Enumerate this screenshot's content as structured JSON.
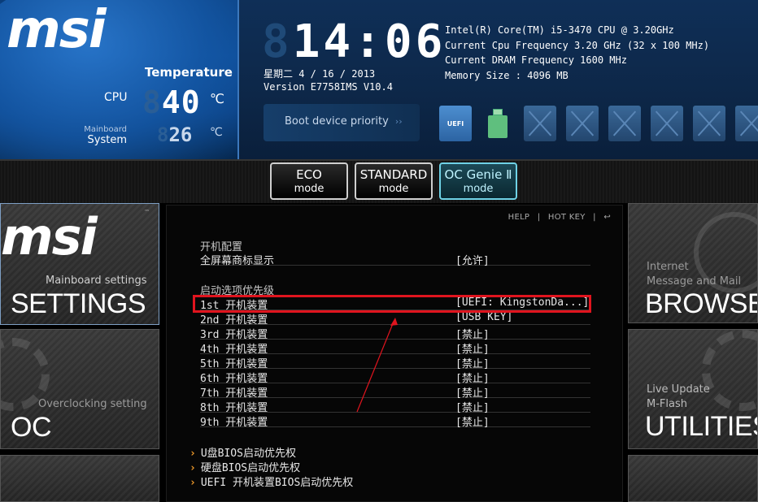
{
  "brand": "msi",
  "temperature": {
    "title": "Temperature",
    "cpu_label": "CPU",
    "cpu_value": "40",
    "mainboard_label": "Mainboard",
    "system_label": "System",
    "system_value": "26",
    "unit": "℃"
  },
  "clock": {
    "time": "14:06",
    "date": "星期二  4 / 16 / 2013",
    "version": "Version E7758IMS V10.4"
  },
  "sysinfo": [
    "Intel(R) Core(TM) i5-3470 CPU @ 3.20GHz",
    "Current Cpu Frequency 3.20 GHz (32 x 100 MHz)",
    "Current DRAM Frequency 1600 MHz",
    "Memory Size : 4096 MB"
  ],
  "boot": {
    "label": "Boot device priority",
    "arrows": "››",
    "uefi_label": "UEFI"
  },
  "modes": [
    {
      "title": "ECO",
      "sub": "mode"
    },
    {
      "title": "STANDARD",
      "sub": "mode"
    },
    {
      "title": "OC Genie Ⅱ",
      "sub": "mode"
    }
  ],
  "tiles": {
    "settings": {
      "sub": "Mainboard settings",
      "big": "SETTINGS",
      "tm": "™"
    },
    "oc": {
      "sub": "Overclocking setting",
      "big": "OC"
    },
    "browser": {
      "sub1": "Internet",
      "sub2": "Message and Mail",
      "big": "BROWSER"
    },
    "utilities": {
      "sub1": "Live Update",
      "sub2": "M-Flash",
      "big": "UTILITIES"
    }
  },
  "helpbar": {
    "help": "HELP",
    "sep": "|",
    "hotkey": "HOT KEY",
    "back": "↩"
  },
  "content": {
    "section1": "开机配置",
    "fullscreen": {
      "label": "全屏幕商标显示",
      "value": "[允许]"
    },
    "section2": "启动选项优先级",
    "boot_rows": [
      {
        "label": "1st 开机装置",
        "value": "[UEFI: KingstonDa...]"
      },
      {
        "label": "2nd 开机装置",
        "value": "[USB KEY]"
      },
      {
        "label": "3rd 开机装置",
        "value": "[禁止]"
      },
      {
        "label": "4th 开机装置",
        "value": "[禁止]"
      },
      {
        "label": "5th 开机装置",
        "value": "[禁止]"
      },
      {
        "label": "6th 开机装置",
        "value": "[禁止]"
      },
      {
        "label": "7th 开机装置",
        "value": "[禁止]"
      },
      {
        "label": "8th 开机装置",
        "value": "[禁止]"
      },
      {
        "label": "9th 开机装置",
        "value": "[禁止]"
      }
    ],
    "links": [
      "U盘BIOS启动优先权",
      "硬盘BIOS启动优先权",
      "UEFI 开机装置BIOS启动优先权"
    ],
    "chevron": "›"
  },
  "colors": {
    "highlight": "#e0141e",
    "accent_orange": "#f09a2a",
    "header_blue": "#0b4a94"
  }
}
